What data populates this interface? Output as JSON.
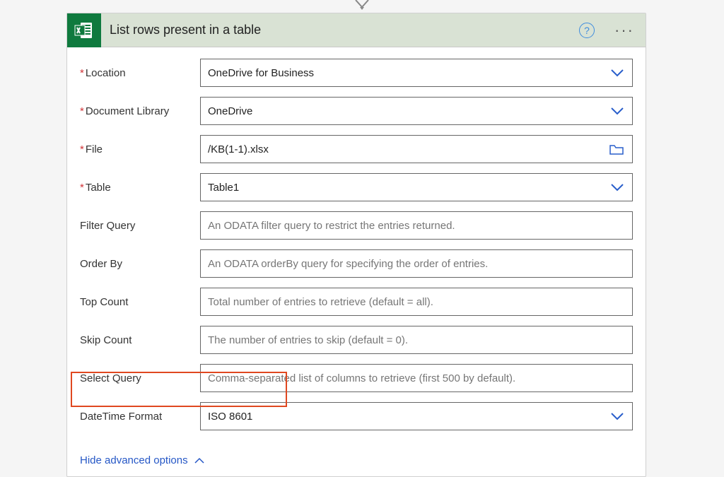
{
  "card": {
    "title": "List rows present in a table"
  },
  "fields": {
    "location": {
      "label": "Location",
      "value": "OneDrive for Business",
      "required": true
    },
    "doclib": {
      "label": "Document Library",
      "value": "OneDrive",
      "required": true
    },
    "file": {
      "label": "File",
      "value": "/KB(1-1).xlsx",
      "required": true
    },
    "table": {
      "label": "Table",
      "value": "Table1",
      "required": true
    },
    "filter": {
      "label": "Filter Query",
      "placeholder": "An ODATA filter query to restrict the entries returned."
    },
    "orderby": {
      "label": "Order By",
      "placeholder": "An ODATA orderBy query for specifying the order of entries."
    },
    "topcount": {
      "label": "Top Count",
      "placeholder": "Total number of entries to retrieve (default = all)."
    },
    "skipcount": {
      "label": "Skip Count",
      "placeholder": "The number of entries to skip (default = 0)."
    },
    "select": {
      "label": "Select Query",
      "placeholder": "Comma-separated list of columns to retrieve (first 500 by default)."
    },
    "datetime": {
      "label": "DateTime Format",
      "value": "ISO 8601"
    }
  },
  "footer": {
    "toggle": "Hide advanced options"
  }
}
